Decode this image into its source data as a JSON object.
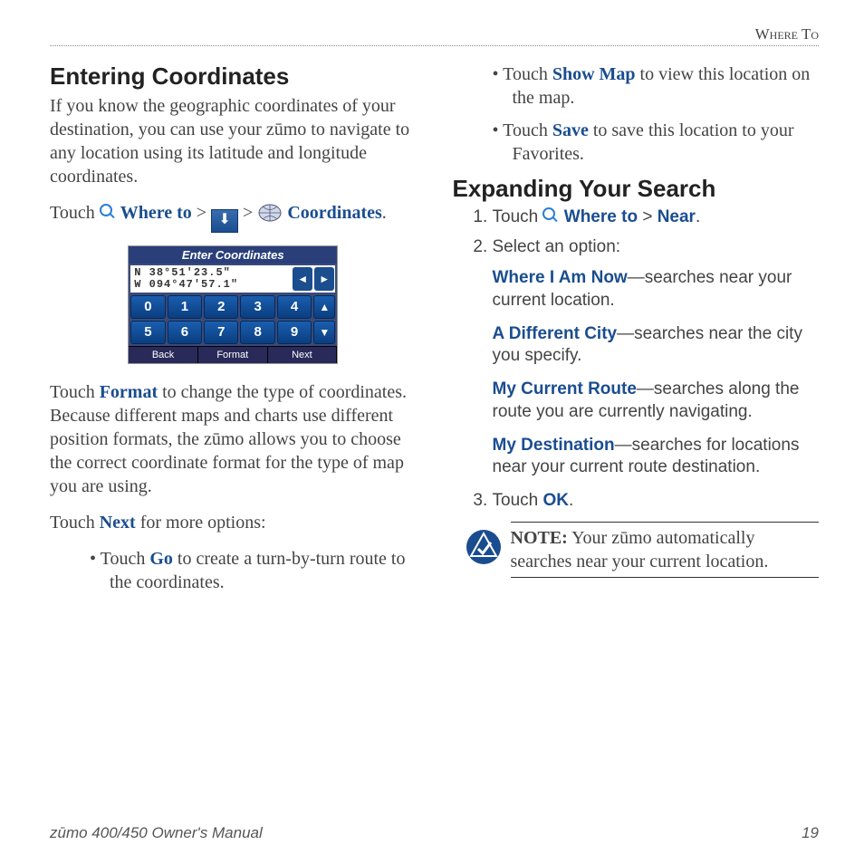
{
  "running_head": "Where To",
  "left": {
    "h_coords": "Entering Coordinates",
    "p_intro": "If you know the geographic coordinates of your destination, you can use your zūmo to navigate to any location using its latitude and longitude coordinates.",
    "touch_prefix": "Touch ",
    "where_to": "Where to",
    "gt": " > ",
    "coords_kw": "Coordinates",
    "period": ".",
    "device": {
      "title": "Enter Coordinates",
      "lat": "N  38°51'23.5\"",
      "lon": "W 094°47'57.1\"",
      "arrows": [
        "◄",
        "►"
      ],
      "keys_row1": [
        "0",
        "1",
        "2",
        "3",
        "4",
        "▲"
      ],
      "keys_row2": [
        "5",
        "6",
        "7",
        "8",
        "9",
        "▼"
      ],
      "footer": [
        "Back",
        "Format",
        "Next"
      ]
    },
    "p_format_a": "Touch ",
    "format_kw": "Format",
    "p_format_b": " to change the type of coordinates. Because different maps and charts use different position formats, the zūmo allows you to choose the correct coordinate format for the type of map you are using.",
    "p_next_a": "Touch ",
    "next_kw": "Next",
    "p_next_b": " for more options:",
    "bullets": {
      "go_a": "Touch ",
      "go_kw": "Go",
      "go_b": " to create a turn-by-turn route to the coordinates.",
      "map_a": "Touch ",
      "map_kw": "Show Map",
      "map_b": " to view this location on the map.",
      "save_a": "Touch ",
      "save_kw": "Save",
      "save_b": " to save this location to your Favorites."
    }
  },
  "right": {
    "h_expand": "Expanding Your Search",
    "s1a": "Touch ",
    "s1_where": "Where to",
    "s1_gt": " > ",
    "s1_near": "Near",
    "s1_end": ".",
    "s2": "Select an option:",
    "opt1_kw": "Where I Am Now",
    "opt1_txt": "—searches near your current location.",
    "opt2_kw": "A Different City",
    "opt2_txt": "—searches near the city you specify.",
    "opt3_kw": "My Current Route",
    "opt3_txt": "—searches along the route you are currently navigating.",
    "opt4_kw": "My Destination",
    "opt4_txt": "—searches for locations near your current route destination.",
    "s3a": "Touch ",
    "s3_ok": "OK",
    "s3_end": ".",
    "note_label": "NOTE:",
    "note_txt": " Your zūmo automatically searches near your current location."
  },
  "footer": {
    "left": "zūmo 400/450 Owner's Manual",
    "right": "19"
  }
}
